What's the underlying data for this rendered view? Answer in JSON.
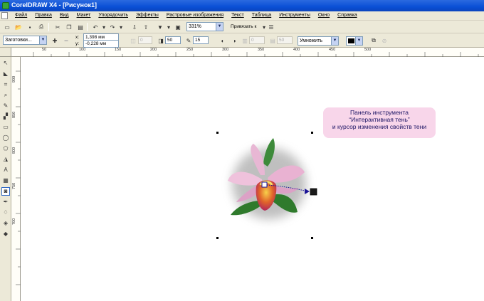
{
  "window": {
    "title": "CorelDRAW X4 - [Рисунок1]"
  },
  "menu": [
    "Файл",
    "Правка",
    "Вид",
    "Макет",
    "Упорядочить",
    "Эффекты",
    "Растровые изображения",
    "Текст",
    "Таблица",
    "Инструменты",
    "Окно",
    "Справка"
  ],
  "toolbar1": {
    "zoom": "331%",
    "snap_label": "Привязать к"
  },
  "toolbar2": {
    "preset": "Заготовки...",
    "offset_x": "1,398 мм",
    "offset_y": "-0,228 мм",
    "x_prefix": "x:",
    "y_prefix": "y:",
    "fade_left": "0",
    "opacity": "50",
    "feather": "15",
    "stretch_a": "0",
    "stretch_b": "50",
    "mode": "Умножить"
  },
  "ruler": {
    "h_ticks": [
      "50",
      "100",
      "150",
      "200",
      "250",
      "300",
      "350",
      "400",
      "450",
      "500"
    ],
    "v_ticks": [
      "900",
      "850",
      "800",
      "750",
      "700"
    ]
  },
  "callout": {
    "line1": "Панель инструмента",
    "line2": "“Интерактивная тень”",
    "line3": "и курсор изменения свойств тени"
  },
  "colors": {
    "title_bar": "#0a4fd6",
    "chrome": "#ece9d8",
    "callout_bg": "#f8d6ea",
    "callout_text": "#1c1464",
    "shadow_arrow": "#1c1496"
  }
}
